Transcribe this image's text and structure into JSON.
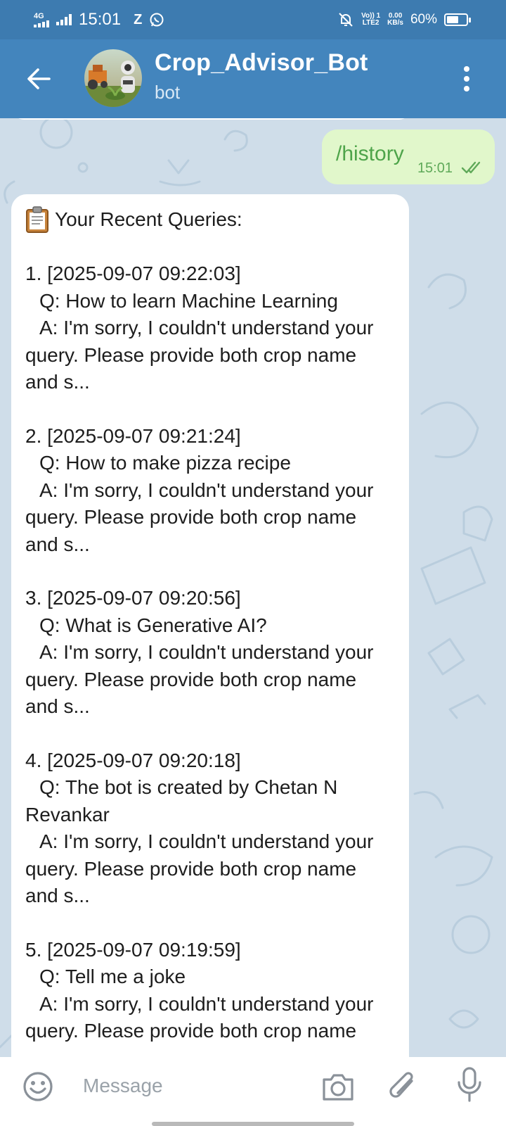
{
  "status_bar": {
    "network_type": "4G",
    "time": "15:01",
    "notif_letter": "Z",
    "volte_line1": "Vo)) 1",
    "volte_line2": "LTE2",
    "speed_value": "0.00",
    "speed_unit": "KB/s",
    "battery_percent": "60%",
    "battery_level": 0.6
  },
  "header": {
    "title": "Crop_Advisor_Bot",
    "subtitle": "bot"
  },
  "outgoing": {
    "text": "/history",
    "time": "15:01"
  },
  "history": {
    "title": "Your Recent Queries:",
    "entries": [
      {
        "stamp": "1. [2025-09-07 09:22:03]",
        "question": "Q: How to learn Machine Learning",
        "answer_line1": "A: I'm sorry, I couldn't understand your",
        "answer_line2": "query. Please provide both crop name",
        "answer_line3": "and s..."
      },
      {
        "stamp": "2. [2025-09-07 09:21:24]",
        "question": "Q: How to make pizza recipe",
        "answer_line1": "A: I'm sorry, I couldn't understand your",
        "answer_line2": "query. Please provide both crop name",
        "answer_line3": "and s..."
      },
      {
        "stamp": "3. [2025-09-07 09:20:56]",
        "question": "Q: What is Generative AI?",
        "answer_line1": "A: I'm sorry, I couldn't understand your",
        "answer_line2": "query. Please provide both crop name",
        "answer_line3": "and s..."
      },
      {
        "stamp": "4. [2025-09-07 09:20:18]",
        "question_line1": "Q: The bot is created by Chetan N",
        "question_line2": "Revankar",
        "answer_line1": "A: I'm sorry, I couldn't understand your",
        "answer_line2": "query. Please provide both crop name",
        "answer_line3": "and s..."
      },
      {
        "stamp": "5. [2025-09-07 09:19:59]",
        "question": "Q: Tell me a joke",
        "answer_line1": "A: I'm sorry, I couldn't understand your",
        "answer_line2": "query. Please provide both crop name"
      }
    ]
  },
  "composer": {
    "placeholder": "Message"
  },
  "colors": {
    "status_bar": "#3d7bb0",
    "header": "#4385bd",
    "chat_background": "#cfdde9",
    "outgoing_bubble": "#e1f7cb",
    "outgoing_text": "#4ea44a"
  },
  "icons": {
    "back": "arrow-left-icon",
    "menu": "more-vertical-icon",
    "read_receipt": "double-check-icon",
    "history_title": "clipboard-icon",
    "emoji": "smiley-icon",
    "camera": "camera-icon",
    "attach": "paperclip-icon",
    "mic": "microphone-icon"
  }
}
